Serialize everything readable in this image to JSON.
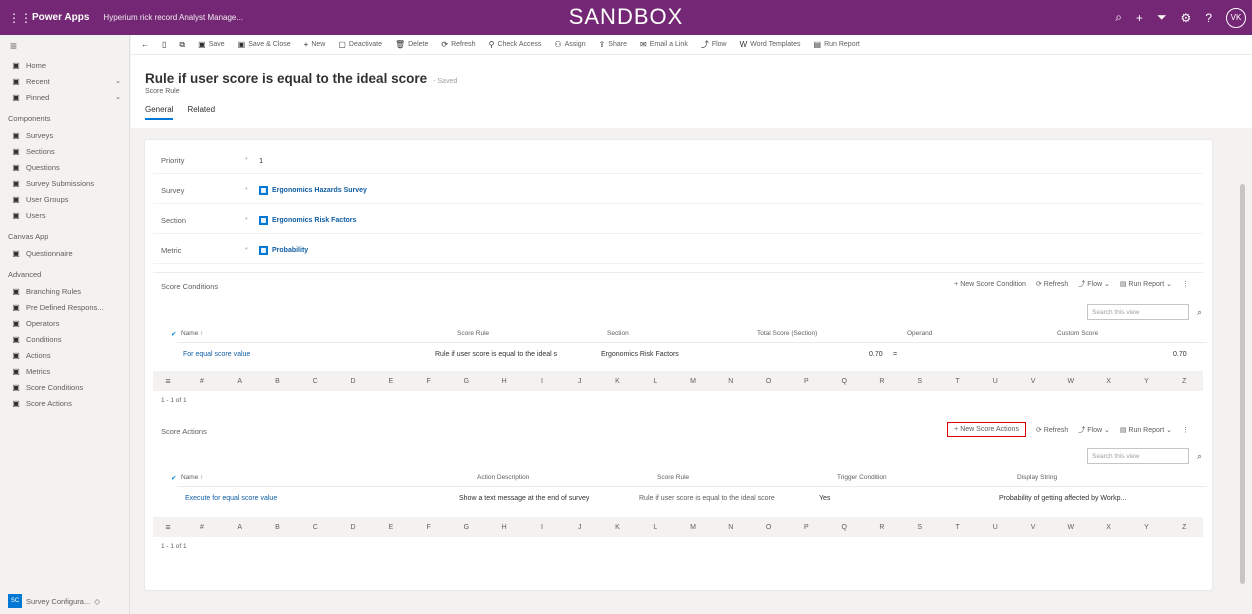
{
  "topbar": {
    "app_name": "Power Apps",
    "env_name": "Hyperium rick record Analyst Manage...",
    "banner": "SANDBOX",
    "user_initials": "VK"
  },
  "nav": {
    "top_items": [
      {
        "label": "Home",
        "icon": "home-icon"
      },
      {
        "label": "Recent",
        "icon": "clock-icon",
        "chevron": true
      },
      {
        "label": "Pinned",
        "icon": "pin-icon",
        "chevron": true
      }
    ],
    "components_label": "Components",
    "components": [
      {
        "label": "Surveys",
        "icon": "survey-icon"
      },
      {
        "label": "Sections",
        "icon": "section-icon"
      },
      {
        "label": "Questions",
        "icon": "question-icon"
      },
      {
        "label": "Survey Submissions",
        "icon": "submission-icon"
      },
      {
        "label": "User Groups",
        "icon": "group-icon"
      },
      {
        "label": "Users",
        "icon": "user-icon"
      }
    ],
    "canvas_label": "Canvas App",
    "canvas": [
      {
        "label": "Questionnaire",
        "icon": "app-icon"
      }
    ],
    "advanced_label": "Advanced",
    "advanced": [
      {
        "label": "Branching Rules",
        "icon": "branch-icon"
      },
      {
        "label": "Pre Defined Respons...",
        "icon": "list-icon"
      },
      {
        "label": "Operators",
        "icon": "operator-icon"
      },
      {
        "label": "Conditions",
        "icon": "condition-icon"
      },
      {
        "label": "Actions",
        "icon": "action-icon"
      },
      {
        "label": "Metrics",
        "icon": "metric-icon"
      },
      {
        "label": "Score Conditions",
        "icon": "score-condition-icon"
      },
      {
        "label": "Score Actions",
        "icon": "score-action-icon"
      }
    ],
    "area_initials": "SC",
    "area_label": "Survey Configura..."
  },
  "cmdbar": [
    {
      "label": "",
      "icon": "back-icon"
    },
    {
      "label": "",
      "icon": "form-icon"
    },
    {
      "label": "",
      "icon": "popout-icon"
    },
    {
      "label": "Save",
      "icon": "save-icon"
    },
    {
      "label": "Save & Close",
      "icon": "save-close-icon"
    },
    {
      "label": "New",
      "icon": "plus-icon"
    },
    {
      "label": "Deactivate",
      "icon": "deactivate-icon"
    },
    {
      "label": "Delete",
      "icon": "delete-icon"
    },
    {
      "label": "Refresh",
      "icon": "refresh-icon"
    },
    {
      "label": "Check Access",
      "icon": "check-access-icon"
    },
    {
      "label": "Assign",
      "icon": "assign-icon"
    },
    {
      "label": "Share",
      "icon": "share-icon"
    },
    {
      "label": "Email a Link",
      "icon": "email-icon"
    },
    {
      "label": "Flow",
      "icon": "flow-icon"
    },
    {
      "label": "Word Templates",
      "icon": "word-icon"
    },
    {
      "label": "Run Report",
      "icon": "report-icon"
    }
  ],
  "header": {
    "title": "Rule if user score is equal to the ideal score",
    "saved": "- Saved",
    "entity": "Score Rule",
    "tabs": [
      "General",
      "Related"
    ]
  },
  "fields": [
    {
      "label": "Priority",
      "value": "1",
      "link": false
    },
    {
      "label": "Survey",
      "value": "Ergonomics Hazards Survey",
      "link": true
    },
    {
      "label": "Section",
      "value": "Ergonomics Risk Factors",
      "link": true
    },
    {
      "label": "Metric",
      "value": "Probability",
      "link": true
    }
  ],
  "score_conditions": {
    "title": "Score Conditions",
    "commands": [
      "New Score Condition",
      "Refresh",
      "Flow",
      "Run Report"
    ],
    "search_placeholder": "Search this view",
    "columns": [
      "Name ↑",
      "Score Rule",
      "Section",
      "Total Score (Section)",
      "Operand",
      "Custom Score"
    ],
    "rows": [
      {
        "name": "For equal score value",
        "rule": "Rule if user score is equal to the ideal s",
        "section": "Ergonomics Risk Factors",
        "total": "0.70",
        "operand": "=",
        "custom": "0.70"
      }
    ],
    "count": "1 - 1 of 1"
  },
  "score_actions": {
    "title": "Score Actions",
    "commands": [
      "New Score Actions",
      "Refresh",
      "Flow",
      "Run Report"
    ],
    "search_placeholder": "Search this view",
    "columns": [
      "Name ↑",
      "Action Description",
      "Score Rule",
      "Trigger Condition",
      "Display String"
    ],
    "rows": [
      {
        "name": "Execute for equal score value",
        "description": "Show a text message at the end of survey",
        "rule": "Rule if user score is equal to the ideal score",
        "trigger": "Yes",
        "display": "Probability of getting affected by Workp..."
      }
    ],
    "count": "1 - 1 of 1"
  },
  "jump_letters": [
    "All",
    "#",
    "A",
    "B",
    "C",
    "D",
    "E",
    "F",
    "G",
    "H",
    "I",
    "J",
    "K",
    "L",
    "M",
    "N",
    "O",
    "P",
    "Q",
    "R",
    "S",
    "T",
    "U",
    "V",
    "W",
    "X",
    "Y",
    "Z"
  ]
}
